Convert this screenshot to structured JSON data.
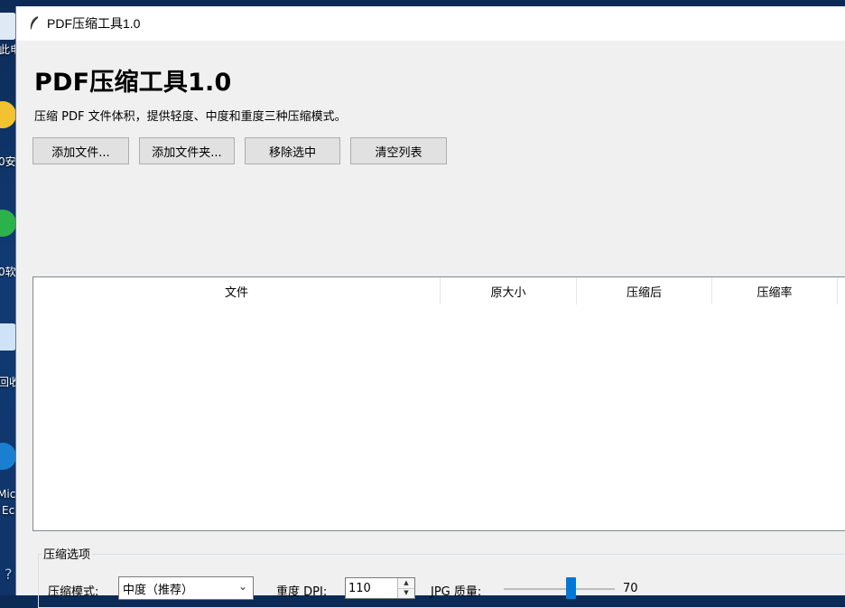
{
  "desktop": {
    "labels": [
      "此电",
      "0安",
      "0软",
      "回收",
      "Micr",
      "Ec",
      "?"
    ]
  },
  "window": {
    "title": "PDF压缩工具1.0"
  },
  "app": {
    "heading": "PDF压缩工具1.0",
    "subtitle": "压缩 PDF 文件体积，提供轻度、中度和重度三种压缩模式。"
  },
  "toolbar": {
    "add_file": "添加文件...",
    "add_folder": "添加文件夹...",
    "remove_selected": "移除选中",
    "clear_list": "清空列表"
  },
  "table": {
    "columns": [
      "文件",
      "原大小",
      "压缩后",
      "压缩率"
    ],
    "rows": []
  },
  "options": {
    "group_title": "压缩选项",
    "mode_label": "压缩模式:",
    "mode_value": "中度（推荐）",
    "dpi_label": "重度 DPI:",
    "dpi_value": "110",
    "jpg_label": "JPG 质量:",
    "jpg_value": "70",
    "jpg_value_fraction": 0.7
  },
  "colors": {
    "accent": "#0078d7",
    "window_bg": "#f0f0f0"
  }
}
